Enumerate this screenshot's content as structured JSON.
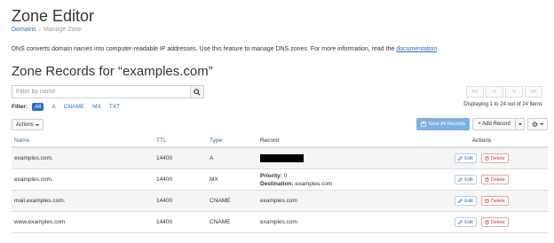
{
  "page": {
    "title": "Zone Editor",
    "breadcrumb": [
      "Domains",
      "Manage Zone"
    ],
    "description_text": "DNS converts domain names into computer-readable IP addresses. Use this feature to manage DNS zones. For more information, read the ",
    "description_link": "documentation",
    "description_end": "."
  },
  "zone": {
    "title": "Zone Records for “examples.com”"
  },
  "search": {
    "placeholder": "Filter by name"
  },
  "filter": {
    "label": "Filter:",
    "options": [
      "All",
      "A",
      "CNAME",
      "MX",
      "TXT"
    ],
    "active": "All"
  },
  "pager": {
    "buttons": [
      "<<",
      "<",
      ">",
      ">>"
    ],
    "info": "Displaying 1 to 24 out of 24 items"
  },
  "toolbar": {
    "actions_label": "Actions",
    "save_all_label": "Save All Records",
    "add_record_label": "+ Add Record"
  },
  "table": {
    "headers": [
      "Name",
      "TTL",
      "Type",
      "Record",
      "Actions"
    ],
    "edit_label": "Edit",
    "delete_label": "Delete",
    "rows": [
      {
        "name": "examples.com.",
        "ttl": "14400",
        "type": "A",
        "record": "",
        "redacted": true
      },
      {
        "name": "examples.com.",
        "ttl": "14400",
        "type": "MX",
        "priority_label": "Priority:",
        "priority": "0",
        "destination_label": "Destination:",
        "destination": "examples.com"
      },
      {
        "name": "mail.examples.com.",
        "ttl": "14400",
        "type": "CNAME",
        "record": "examples.com"
      },
      {
        "name": "www.examples.com.",
        "ttl": "14400",
        "type": "CNAME",
        "record": "examples.com"
      }
    ]
  },
  "colors": {
    "link": "#2a6ebb",
    "primary_button": "#7fb0df",
    "delete": "#c9302c"
  }
}
